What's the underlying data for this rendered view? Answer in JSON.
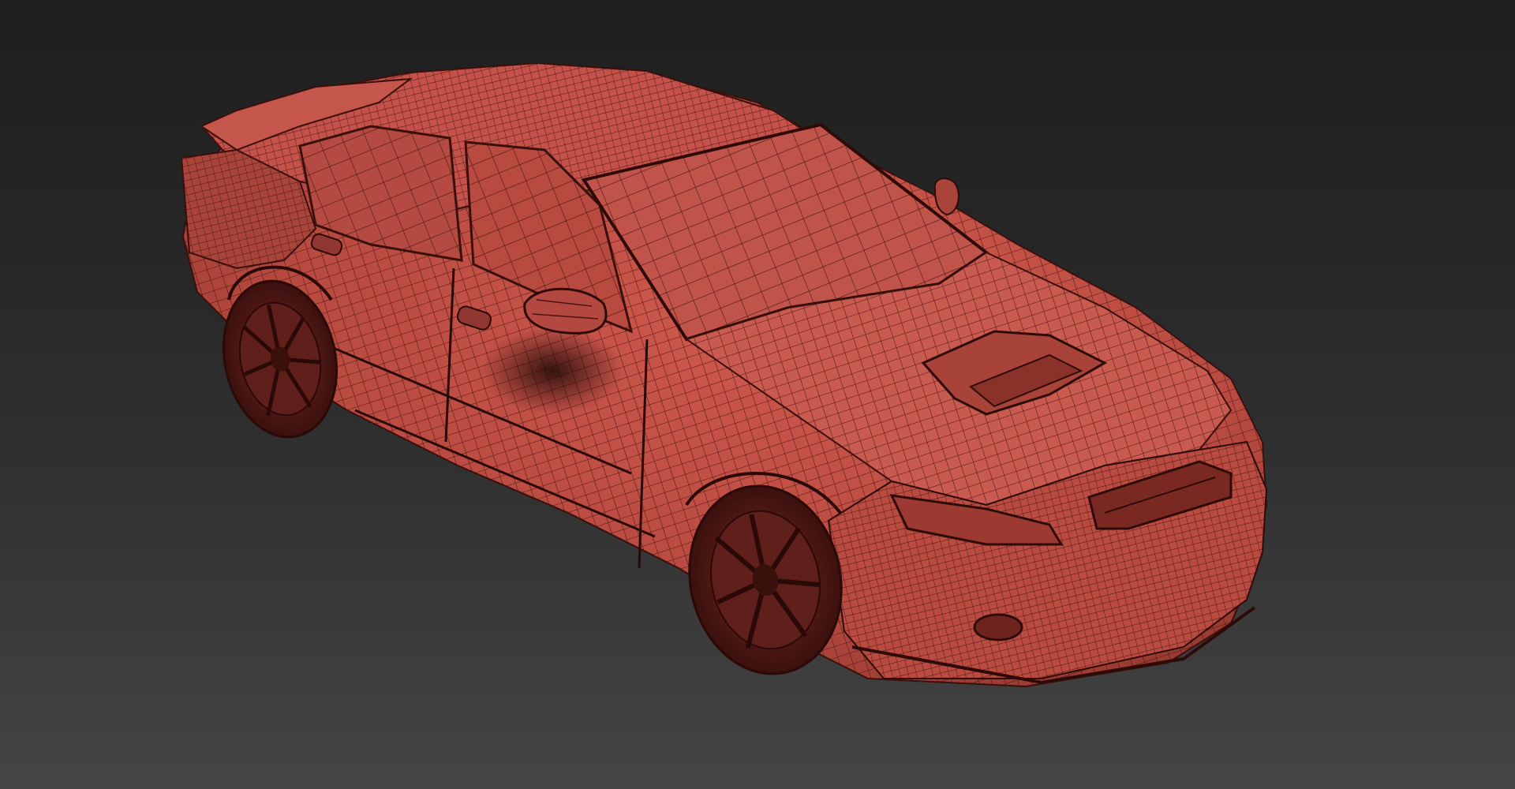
{
  "viewport": {
    "background_top": "#1f1f1f",
    "background_bottom": "#454545",
    "render_mode": "wireframe-on-shaded"
  },
  "model": {
    "subject": "sedan-car",
    "body_color": "#b84a40",
    "body_shadow_color": "#7a2a24",
    "wire_color": "#4a1512",
    "tire_color": "#5a1c18"
  }
}
